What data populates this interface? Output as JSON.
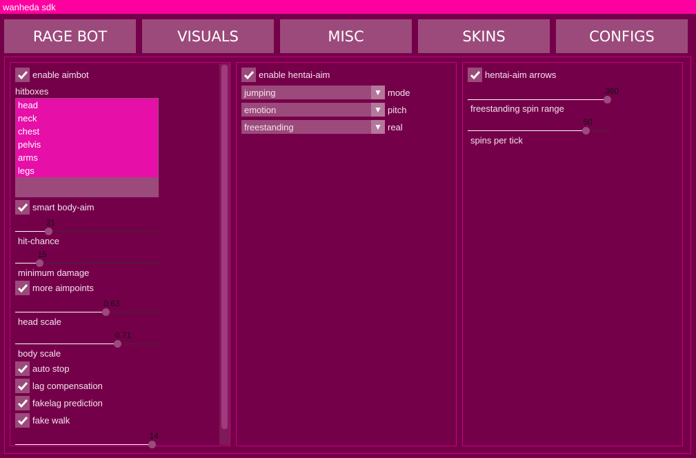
{
  "window": {
    "title": "wanheda sdk"
  },
  "tabs": [
    {
      "label": "RAGE BOT"
    },
    {
      "label": "VISUALS"
    },
    {
      "label": "MISC"
    },
    {
      "label": "SKINS"
    },
    {
      "label": "CONFIGS"
    }
  ],
  "colors": {
    "titlebar": "#ff00a0",
    "background": "#75004a",
    "control": "#9c4a7b",
    "border": "#c8007e",
    "selected": "#e60fa8"
  },
  "ragebot": {
    "enable_aimbot": {
      "label": "enable aimbot",
      "checked": true
    },
    "hitboxes_label": "hitboxes",
    "hitboxes": [
      "head",
      "neck",
      "chest",
      "pelvis",
      "arms",
      "legs"
    ],
    "smart_body_aim": {
      "label": "smart body-aim",
      "checked": true
    },
    "hit_chance": {
      "label": "hit-chance",
      "value": "21",
      "fill": 23
    },
    "min_damage": {
      "label": "minimum damage",
      "value": "15",
      "fill": 17
    },
    "more_aimpoints": {
      "label": "more aimpoints",
      "checked": true
    },
    "head_scale": {
      "label": "head scale",
      "value": "0.63",
      "fill": 63
    },
    "body_scale": {
      "label": "body scale",
      "value": "0.71",
      "fill": 71
    },
    "auto_stop": {
      "label": "auto stop",
      "checked": true
    },
    "lag_comp": {
      "label": "lag compensation",
      "checked": true
    },
    "fakelag_pred": {
      "label": "fakelag prediction",
      "checked": true
    },
    "fake_walk": {
      "label": "fake walk",
      "checked": true
    },
    "fake_walk_slider": {
      "value": "14",
      "fill": 95
    }
  },
  "hentai": {
    "enable": {
      "label": "enable hentai-aim",
      "checked": true
    },
    "dropdowns": [
      {
        "value": "jumping",
        "label": "mode"
      },
      {
        "value": "emotion",
        "label": "pitch"
      },
      {
        "value": "freestanding",
        "label": "real"
      }
    ]
  },
  "arrows": {
    "enable": {
      "label": "hentai-aim arrows",
      "checked": true
    },
    "spin_range": {
      "label": "freestanding spin range",
      "value": "360",
      "fill": 100
    },
    "spins_per_tick": {
      "label": "spins per tick",
      "value": "50",
      "fill": 82
    }
  }
}
